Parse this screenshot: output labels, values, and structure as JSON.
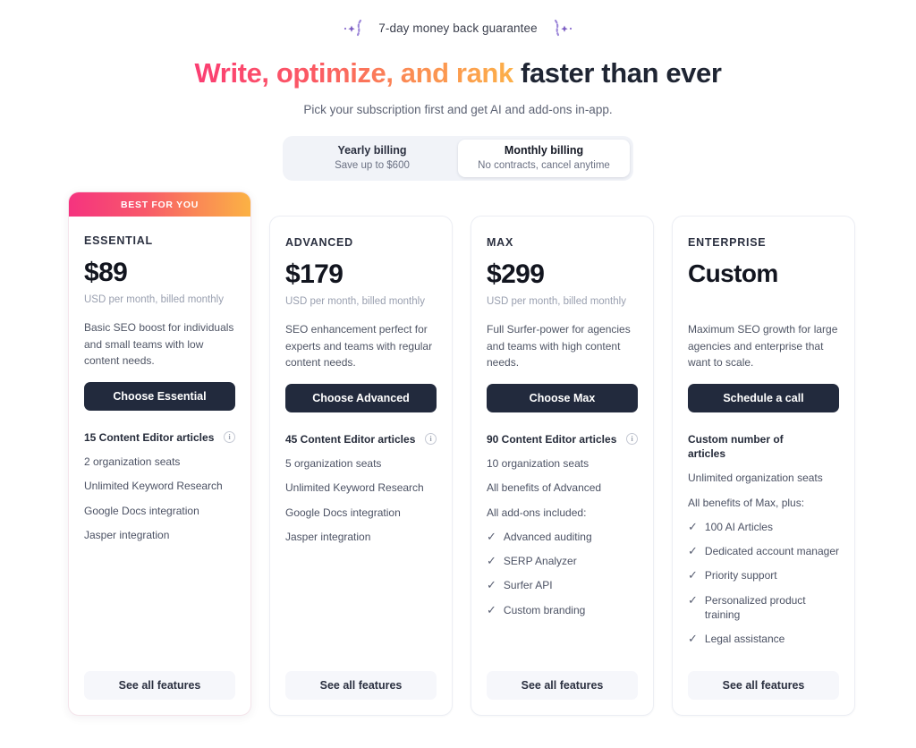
{
  "header": {
    "guarantee": "7-day money back guarantee",
    "headline_gradient": "Write, optimize, and rank",
    "headline_rest": " faster than ever",
    "subhead": "Pick your subscription first and get AI and add-ons in-app.",
    "accent_pink": "#f5337f",
    "accent_orange": "#fbb244",
    "sparkle_color": "#7d5fc4"
  },
  "billing": {
    "options": [
      {
        "title": "Yearly billing",
        "sub": "Save up to $600",
        "active": false
      },
      {
        "title": "Monthly billing",
        "sub": "No contracts, cancel anytime",
        "active": true
      }
    ]
  },
  "plans": [
    {
      "badge": "BEST FOR YOU",
      "name": "ESSENTIAL",
      "price": "$89",
      "price_note": "USD per month, billed monthly",
      "description": "Basic SEO boost for individuals and small teams with low content needs.",
      "cta": "Choose Essential",
      "see_all": "See all features",
      "features": [
        {
          "text": "15 Content Editor articles",
          "info": true,
          "check": false,
          "emphasis": true
        },
        {
          "text": "2 organization seats",
          "info": false,
          "check": false,
          "emphasis": false
        },
        {
          "text": "Unlimited Keyword Research",
          "info": false,
          "check": false,
          "emphasis": false
        },
        {
          "text": "Google Docs integration",
          "info": false,
          "check": false,
          "emphasis": false
        },
        {
          "text": "Jasper integration",
          "info": false,
          "check": false,
          "emphasis": false
        }
      ]
    },
    {
      "badge": "",
      "name": "ADVANCED",
      "price": "$179",
      "price_note": "USD per month, billed monthly",
      "description": "SEO enhancement perfect for experts and teams with regular content needs.",
      "cta": "Choose Advanced",
      "see_all": "See all features",
      "features": [
        {
          "text": "45 Content Editor articles",
          "info": true,
          "check": false,
          "emphasis": true
        },
        {
          "text": "5 organization seats",
          "info": false,
          "check": false,
          "emphasis": false
        },
        {
          "text": "Unlimited Keyword Research",
          "info": false,
          "check": false,
          "emphasis": false
        },
        {
          "text": "Google Docs integration",
          "info": false,
          "check": false,
          "emphasis": false
        },
        {
          "text": "Jasper integration",
          "info": false,
          "check": false,
          "emphasis": false
        }
      ]
    },
    {
      "badge": "",
      "name": "MAX",
      "price": "$299",
      "price_note": "USD per month, billed monthly",
      "description": "Full Surfer-power for agencies and teams with high content needs.",
      "cta": "Choose Max",
      "see_all": "See all features",
      "features": [
        {
          "text": "90 Content Editor articles",
          "info": true,
          "check": false,
          "emphasis": true
        },
        {
          "text": "10 organization seats",
          "info": false,
          "check": false,
          "emphasis": false
        },
        {
          "text": "All benefits of Advanced",
          "info": false,
          "check": false,
          "emphasis": false
        },
        {
          "text": "All add-ons included:",
          "info": false,
          "check": false,
          "emphasis": false
        },
        {
          "text": "Advanced auditing",
          "info": false,
          "check": true,
          "emphasis": false
        },
        {
          "text": "SERP Analyzer",
          "info": false,
          "check": true,
          "emphasis": false
        },
        {
          "text": "Surfer API",
          "info": false,
          "check": true,
          "emphasis": false
        },
        {
          "text": "Custom branding",
          "info": false,
          "check": true,
          "emphasis": false
        }
      ]
    },
    {
      "badge": "",
      "name": "ENTERPRISE",
      "price": "Custom",
      "price_note": "",
      "description": "Maximum SEO growth for large agencies and enterprise that want to scale.",
      "cta": "Schedule a call",
      "see_all": "See all features",
      "features": [
        {
          "text": "Custom number of articles",
          "info": false,
          "check": false,
          "emphasis": true
        },
        {
          "text": "Unlimited organization seats",
          "info": false,
          "check": false,
          "emphasis": false
        },
        {
          "text": "All benefits of Max, plus:",
          "info": false,
          "check": false,
          "emphasis": false
        },
        {
          "text": "100 AI Articles",
          "info": false,
          "check": true,
          "emphasis": false
        },
        {
          "text": "Dedicated account manager",
          "info": false,
          "check": true,
          "emphasis": false
        },
        {
          "text": "Priority support",
          "info": false,
          "check": true,
          "emphasis": false
        },
        {
          "text": "Personalized product training",
          "info": false,
          "check": true,
          "emphasis": false
        },
        {
          "text": "Legal assistance",
          "info": false,
          "check": true,
          "emphasis": false
        }
      ]
    }
  ],
  "icons": {
    "info": "i",
    "check": "✓"
  }
}
